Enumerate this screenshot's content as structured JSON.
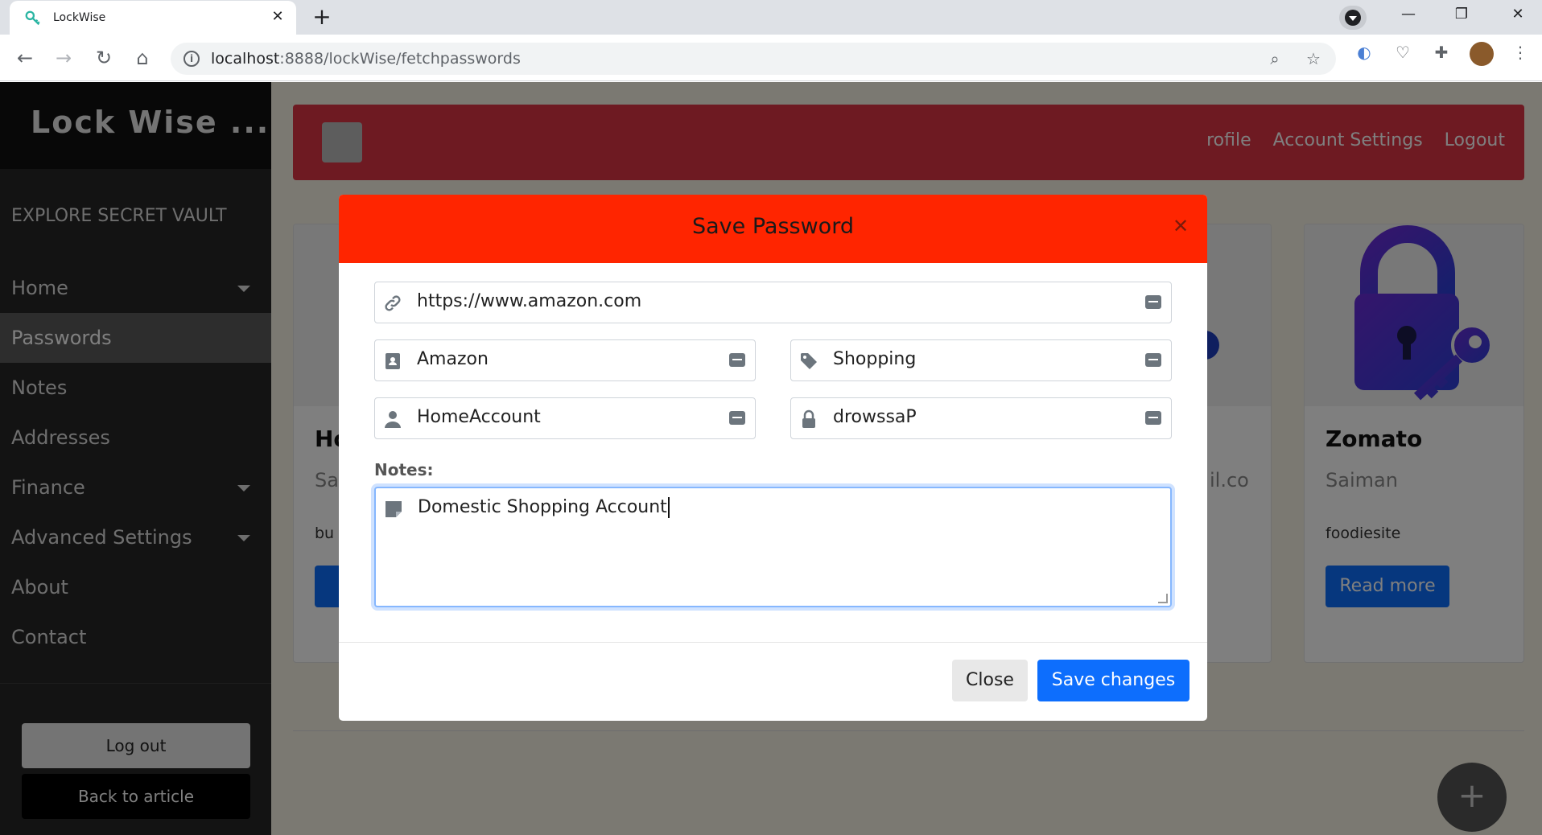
{
  "browser": {
    "tab_title": "LockWise",
    "url_host": "localhost",
    "url_rest": ":8888/lockWise/fetchpasswords",
    "new_tab_icon": "plus-icon"
  },
  "sidebar": {
    "brand": "Lock Wise ...",
    "explore": "EXPLORE SECRET VAULT",
    "items": [
      {
        "label": "Home",
        "has_dropdown": true
      },
      {
        "label": "Passwords",
        "active": true
      },
      {
        "label": "Notes"
      },
      {
        "label": "Addresses"
      },
      {
        "label": "Finance",
        "has_dropdown": true
      },
      {
        "label": "Advanced Settings",
        "has_dropdown": true
      },
      {
        "label": "About"
      },
      {
        "label": "Contact"
      }
    ],
    "logout_label": "Log out",
    "back_label": "Back to article"
  },
  "navbar": {
    "links": [
      "rofile",
      "Account Settings",
      "Logout"
    ]
  },
  "cards": [
    {
      "title": "Ho",
      "subtitle": "Sa",
      "text": "bu",
      "button": "R"
    },
    {
      "title": "",
      "subtitle": "",
      "text": "",
      "button": ""
    },
    {
      "title": "",
      "subtitle": "",
      "text": "",
      "button": ""
    },
    {
      "title": "",
      "subtitle": "il.co",
      "text": "",
      "button": ""
    },
    {
      "title": "Zomato",
      "subtitle": "Saiman",
      "text": "foodiesite",
      "button": "Read more"
    }
  ],
  "modal": {
    "title": "Save Password",
    "close_icon": "close-icon",
    "url_value": "https://www.amazon.com",
    "name_value": "Amazon",
    "category_value": "Shopping",
    "username_value": "HomeAccount",
    "password_value": "drowssaP",
    "notes_label": "Notes:",
    "notes_value": "Domestic Shopping Account",
    "close_button": "Close",
    "save_button": "Save changes"
  },
  "fab_label": "+",
  "colors": {
    "modal_header": "#ff2500",
    "primary": "#0d6efd",
    "navbar": "#dc3545",
    "sidebar": "#262626"
  }
}
